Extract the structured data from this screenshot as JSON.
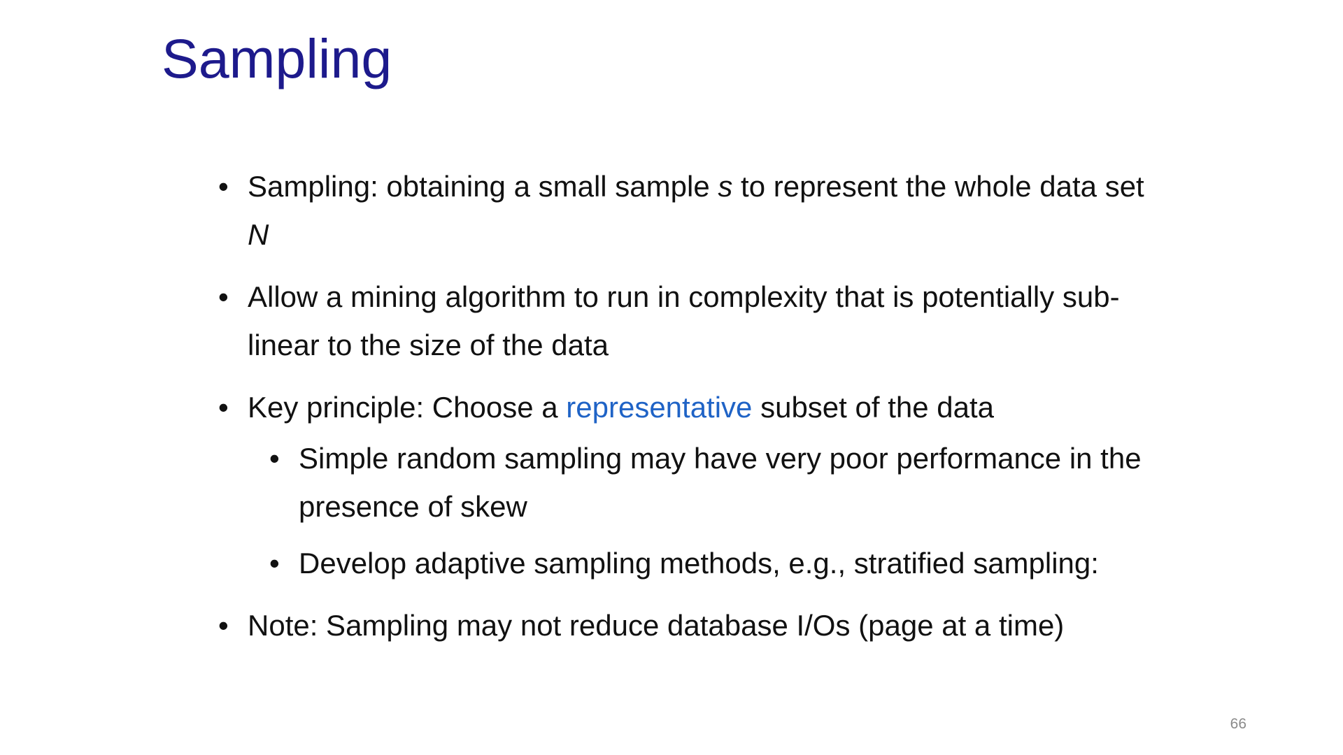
{
  "slide": {
    "title": "Sampling",
    "page_number": "66",
    "bullet_char": "•",
    "colors": {
      "title": "#1d1a8c",
      "text": "#111111",
      "highlight": "#1f63c6",
      "page_number": "#8a8a8a"
    },
    "bullets": {
      "b1": {
        "text_a": "Sampling: obtaining a small sample ",
        "var_s": "s",
        "text_b": " to represent the whole data set ",
        "var_n": "N"
      },
      "b2": {
        "text": "Allow a mining algorithm to run in complexity that is potentially sub-linear to the size of the data"
      },
      "b3": {
        "text_a": "Key principle: Choose a ",
        "highlight": "representative",
        "text_b": " subset of the data",
        "subs": [
          "Simple random sampling may have very poor performance in the presence of skew",
          "Develop adaptive sampling methods, e.g., stratified sampling:"
        ]
      },
      "b4": {
        "text": "Note: Sampling may not reduce database I/Os (page at a time)"
      }
    }
  }
}
